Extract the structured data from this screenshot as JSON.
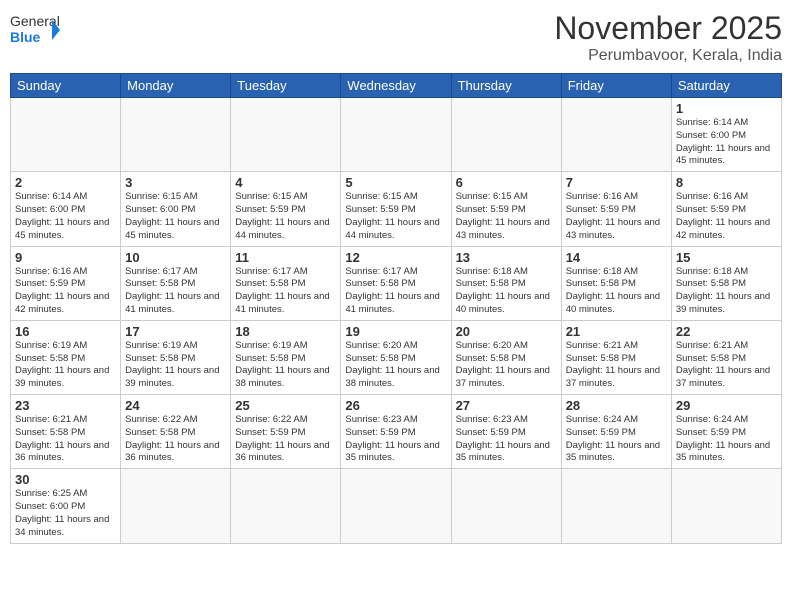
{
  "header": {
    "logo_general": "General",
    "logo_blue": "Blue",
    "month_title": "November 2025",
    "location": "Perumbavoor, Kerala, India"
  },
  "weekdays": [
    "Sunday",
    "Monday",
    "Tuesday",
    "Wednesday",
    "Thursday",
    "Friday",
    "Saturday"
  ],
  "weeks": [
    [
      {
        "date": "",
        "text": ""
      },
      {
        "date": "",
        "text": ""
      },
      {
        "date": "",
        "text": ""
      },
      {
        "date": "",
        "text": ""
      },
      {
        "date": "",
        "text": ""
      },
      {
        "date": "",
        "text": ""
      },
      {
        "date": "1",
        "text": "Sunrise: 6:14 AM\nSunset: 6:00 PM\nDaylight: 11 hours\nand 45 minutes."
      }
    ],
    [
      {
        "date": "2",
        "text": "Sunrise: 6:14 AM\nSunset: 6:00 PM\nDaylight: 11 hours\nand 45 minutes."
      },
      {
        "date": "3",
        "text": "Sunrise: 6:15 AM\nSunset: 6:00 PM\nDaylight: 11 hours\nand 45 minutes."
      },
      {
        "date": "4",
        "text": "Sunrise: 6:15 AM\nSunset: 5:59 PM\nDaylight: 11 hours\nand 44 minutes."
      },
      {
        "date": "5",
        "text": "Sunrise: 6:15 AM\nSunset: 5:59 PM\nDaylight: 11 hours\nand 44 minutes."
      },
      {
        "date": "6",
        "text": "Sunrise: 6:15 AM\nSunset: 5:59 PM\nDaylight: 11 hours\nand 43 minutes."
      },
      {
        "date": "7",
        "text": "Sunrise: 6:16 AM\nSunset: 5:59 PM\nDaylight: 11 hours\nand 43 minutes."
      },
      {
        "date": "8",
        "text": "Sunrise: 6:16 AM\nSunset: 5:59 PM\nDaylight: 11 hours\nand 42 minutes."
      }
    ],
    [
      {
        "date": "9",
        "text": "Sunrise: 6:16 AM\nSunset: 5:59 PM\nDaylight: 11 hours\nand 42 minutes."
      },
      {
        "date": "10",
        "text": "Sunrise: 6:17 AM\nSunset: 5:58 PM\nDaylight: 11 hours\nand 41 minutes."
      },
      {
        "date": "11",
        "text": "Sunrise: 6:17 AM\nSunset: 5:58 PM\nDaylight: 11 hours\nand 41 minutes."
      },
      {
        "date": "12",
        "text": "Sunrise: 6:17 AM\nSunset: 5:58 PM\nDaylight: 11 hours\nand 41 minutes."
      },
      {
        "date": "13",
        "text": "Sunrise: 6:18 AM\nSunset: 5:58 PM\nDaylight: 11 hours\nand 40 minutes."
      },
      {
        "date": "14",
        "text": "Sunrise: 6:18 AM\nSunset: 5:58 PM\nDaylight: 11 hours\nand 40 minutes."
      },
      {
        "date": "15",
        "text": "Sunrise: 6:18 AM\nSunset: 5:58 PM\nDaylight: 11 hours\nand 39 minutes."
      }
    ],
    [
      {
        "date": "16",
        "text": "Sunrise: 6:19 AM\nSunset: 5:58 PM\nDaylight: 11 hours\nand 39 minutes."
      },
      {
        "date": "17",
        "text": "Sunrise: 6:19 AM\nSunset: 5:58 PM\nDaylight: 11 hours\nand 39 minutes."
      },
      {
        "date": "18",
        "text": "Sunrise: 6:19 AM\nSunset: 5:58 PM\nDaylight: 11 hours\nand 38 minutes."
      },
      {
        "date": "19",
        "text": "Sunrise: 6:20 AM\nSunset: 5:58 PM\nDaylight: 11 hours\nand 38 minutes."
      },
      {
        "date": "20",
        "text": "Sunrise: 6:20 AM\nSunset: 5:58 PM\nDaylight: 11 hours\nand 37 minutes."
      },
      {
        "date": "21",
        "text": "Sunrise: 6:21 AM\nSunset: 5:58 PM\nDaylight: 11 hours\nand 37 minutes."
      },
      {
        "date": "22",
        "text": "Sunrise: 6:21 AM\nSunset: 5:58 PM\nDaylight: 11 hours\nand 37 minutes."
      }
    ],
    [
      {
        "date": "23",
        "text": "Sunrise: 6:21 AM\nSunset: 5:58 PM\nDaylight: 11 hours\nand 36 minutes."
      },
      {
        "date": "24",
        "text": "Sunrise: 6:22 AM\nSunset: 5:58 PM\nDaylight: 11 hours\nand 36 minutes."
      },
      {
        "date": "25",
        "text": "Sunrise: 6:22 AM\nSunset: 5:59 PM\nDaylight: 11 hours\nand 36 minutes."
      },
      {
        "date": "26",
        "text": "Sunrise: 6:23 AM\nSunset: 5:59 PM\nDaylight: 11 hours\nand 35 minutes."
      },
      {
        "date": "27",
        "text": "Sunrise: 6:23 AM\nSunset: 5:59 PM\nDaylight: 11 hours\nand 35 minutes."
      },
      {
        "date": "28",
        "text": "Sunrise: 6:24 AM\nSunset: 5:59 PM\nDaylight: 11 hours\nand 35 minutes."
      },
      {
        "date": "29",
        "text": "Sunrise: 6:24 AM\nSunset: 5:59 PM\nDaylight: 11 hours\nand 35 minutes."
      }
    ],
    [
      {
        "date": "30",
        "text": "Sunrise: 6:25 AM\nSunset: 6:00 PM\nDaylight: 11 hours\nand 34 minutes."
      },
      {
        "date": "",
        "text": ""
      },
      {
        "date": "",
        "text": ""
      },
      {
        "date": "",
        "text": ""
      },
      {
        "date": "",
        "text": ""
      },
      {
        "date": "",
        "text": ""
      },
      {
        "date": "",
        "text": ""
      }
    ]
  ]
}
